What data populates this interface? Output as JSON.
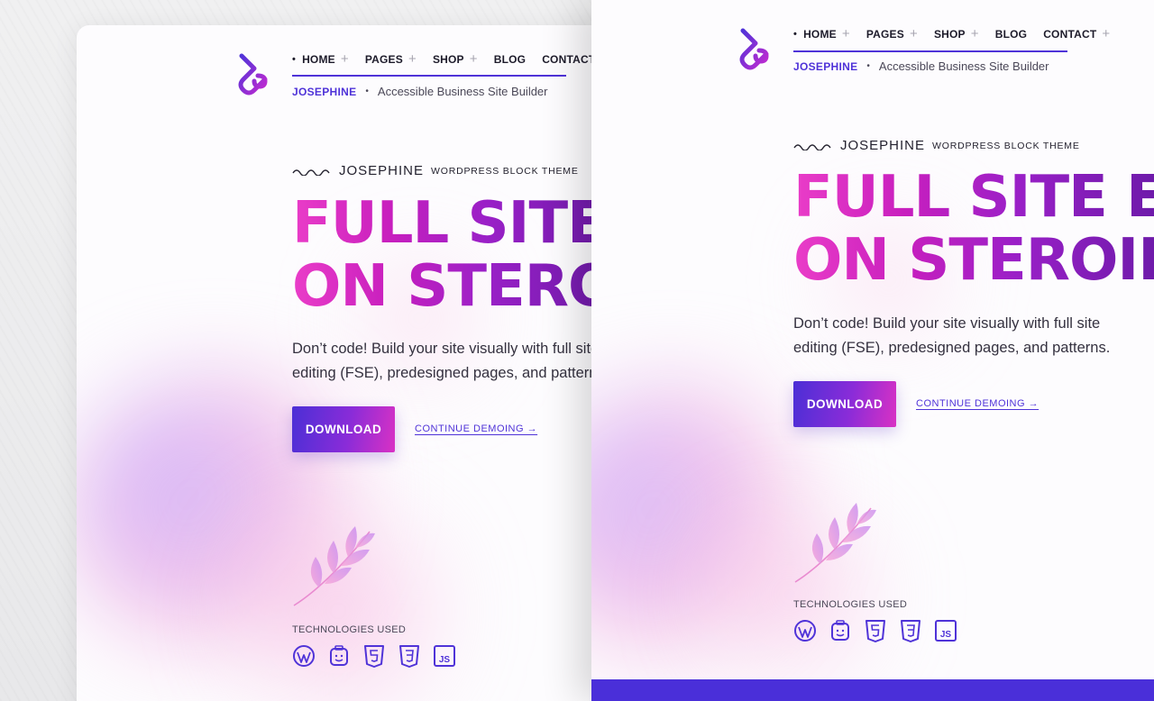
{
  "nav": {
    "items": [
      {
        "label": "Home",
        "active": true
      },
      {
        "label": "Pages",
        "has_submenu": true
      },
      {
        "label": "Shop",
        "has_submenu": true
      },
      {
        "label": "Blog",
        "has_submenu": false
      },
      {
        "label": "Contact",
        "has_submenu": true
      }
    ],
    "submenu_icon": "plus-icon"
  },
  "site": {
    "brand": "JOSEPHINE",
    "tagline": "Accessible Business Site Builder",
    "logo_icon": "josephine-logo"
  },
  "hero": {
    "eyebrow_name": "JOSEPHINE",
    "eyebrow_sub": "WordPress Block Theme",
    "headline_line1_back": "FULL SITE",
    "headline_line2_back": "ON STERO",
    "headline_line1_front": "FULL SITE E",
    "headline_line2_front": "ON STEROII",
    "lead": "Don’t code! Build your site visually with full site editing (FSE), predesigned pages, and patterns.",
    "download_label": "DOWNLOAD",
    "demo_label": "CONTINUE DEMOING →"
  },
  "tech": {
    "label": "TECHNOLOGIES USED",
    "icons": [
      "wordpress-icon",
      "gutenberg-icon",
      "html5-icon",
      "css3-icon",
      "javascript-icon"
    ],
    "js_text": "JS"
  },
  "colors": {
    "accent": "#4f33d8",
    "headline_gradient": [
      "#ea3dc8",
      "#6b1aa8"
    ],
    "bottom_bar": "#4a2fd9"
  }
}
